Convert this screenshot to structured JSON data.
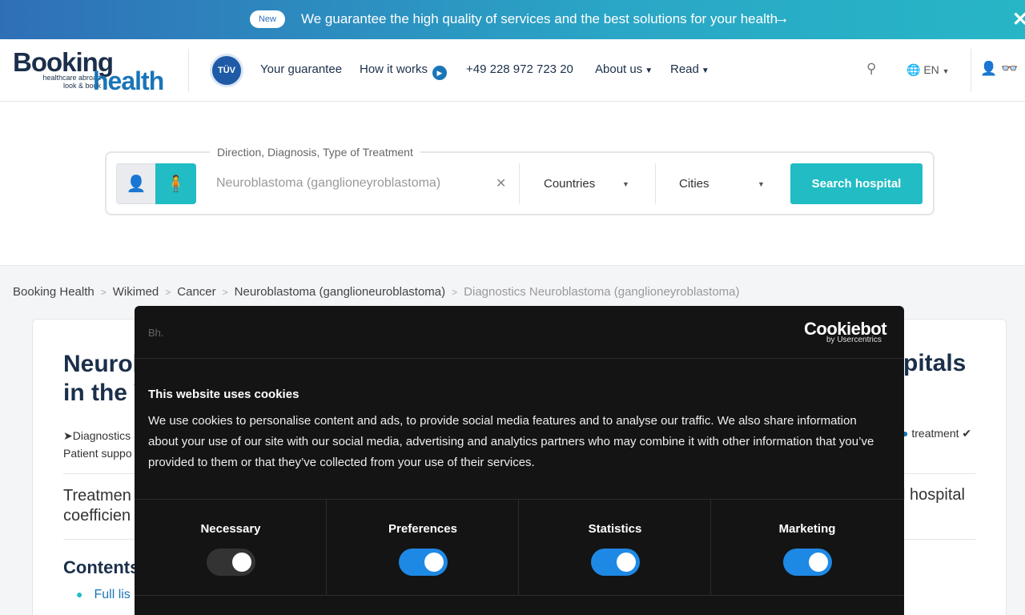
{
  "banner": {
    "badge": "New",
    "text": "We guarantee the high quality of services and the best solutions for your health",
    "arrow": "→",
    "close": "✕"
  },
  "header": {
    "logo_booking": "Booking",
    "logo_tagline": "healthcare abroad\nlook & book",
    "logo_health": "health",
    "tuv_badge": "TÜV",
    "nav": {
      "guarantee": "Your guarantee",
      "how_it_works": "How it works",
      "phone": "+49 228 972 723 20",
      "about": "About us",
      "read": "Read"
    },
    "lang": "EN"
  },
  "search": {
    "legend": "Direction, Diagnosis, Type of Treatment",
    "diagnosis_value": "Neuroblastoma (ganglioneyroblastoma)",
    "countries": "Countries",
    "cities": "Cities",
    "button": "Search hospital"
  },
  "breadcrumb": {
    "items": [
      "Booking Health",
      "Wikimed",
      "Cancer",
      "Neuroblastoma (ganglioneuroblastoma)"
    ],
    "current": "Diagnostics Neuroblastoma (ganglioneyroblastoma)"
  },
  "content": {
    "title_left_1": "Neurob",
    "title_left_2": "in the W",
    "title_right": "pitals",
    "feat_left_1": "➤Diagnostics",
    "feat_left_2": "Patient suppo",
    "feat_right": "treatment ✔",
    "treat_left_1": "Treatmen",
    "treat_left_2": "coefficien",
    "treat_right": "l hospital",
    "contents_heading": "Contents",
    "list_item_1": "Full lis"
  },
  "cookie": {
    "brand_small": "Bh.",
    "logo": "Cookiebot",
    "logo_sub": "by Usercentrics",
    "title": "This website uses cookies",
    "text": "We use cookies to personalise content and ads, to provide social media features and to analyse our traffic. We also share information about your use of our site with our social media, advertising and analytics partners who may combine it with other information that you’ve provided to them or that they’ve collected from your use of their services.",
    "categories": [
      {
        "label": "Necessary",
        "enabled": true,
        "locked": true
      },
      {
        "label": "Preferences",
        "enabled": true
      },
      {
        "label": "Statistics",
        "enabled": true
      },
      {
        "label": "Marketing",
        "enabled": true
      }
    ]
  },
  "colors": {
    "accent": "#21bcc4",
    "brand_blue": "#1a75b7",
    "cookie_bg": "#141414",
    "switch_on": "#1e88e5"
  }
}
